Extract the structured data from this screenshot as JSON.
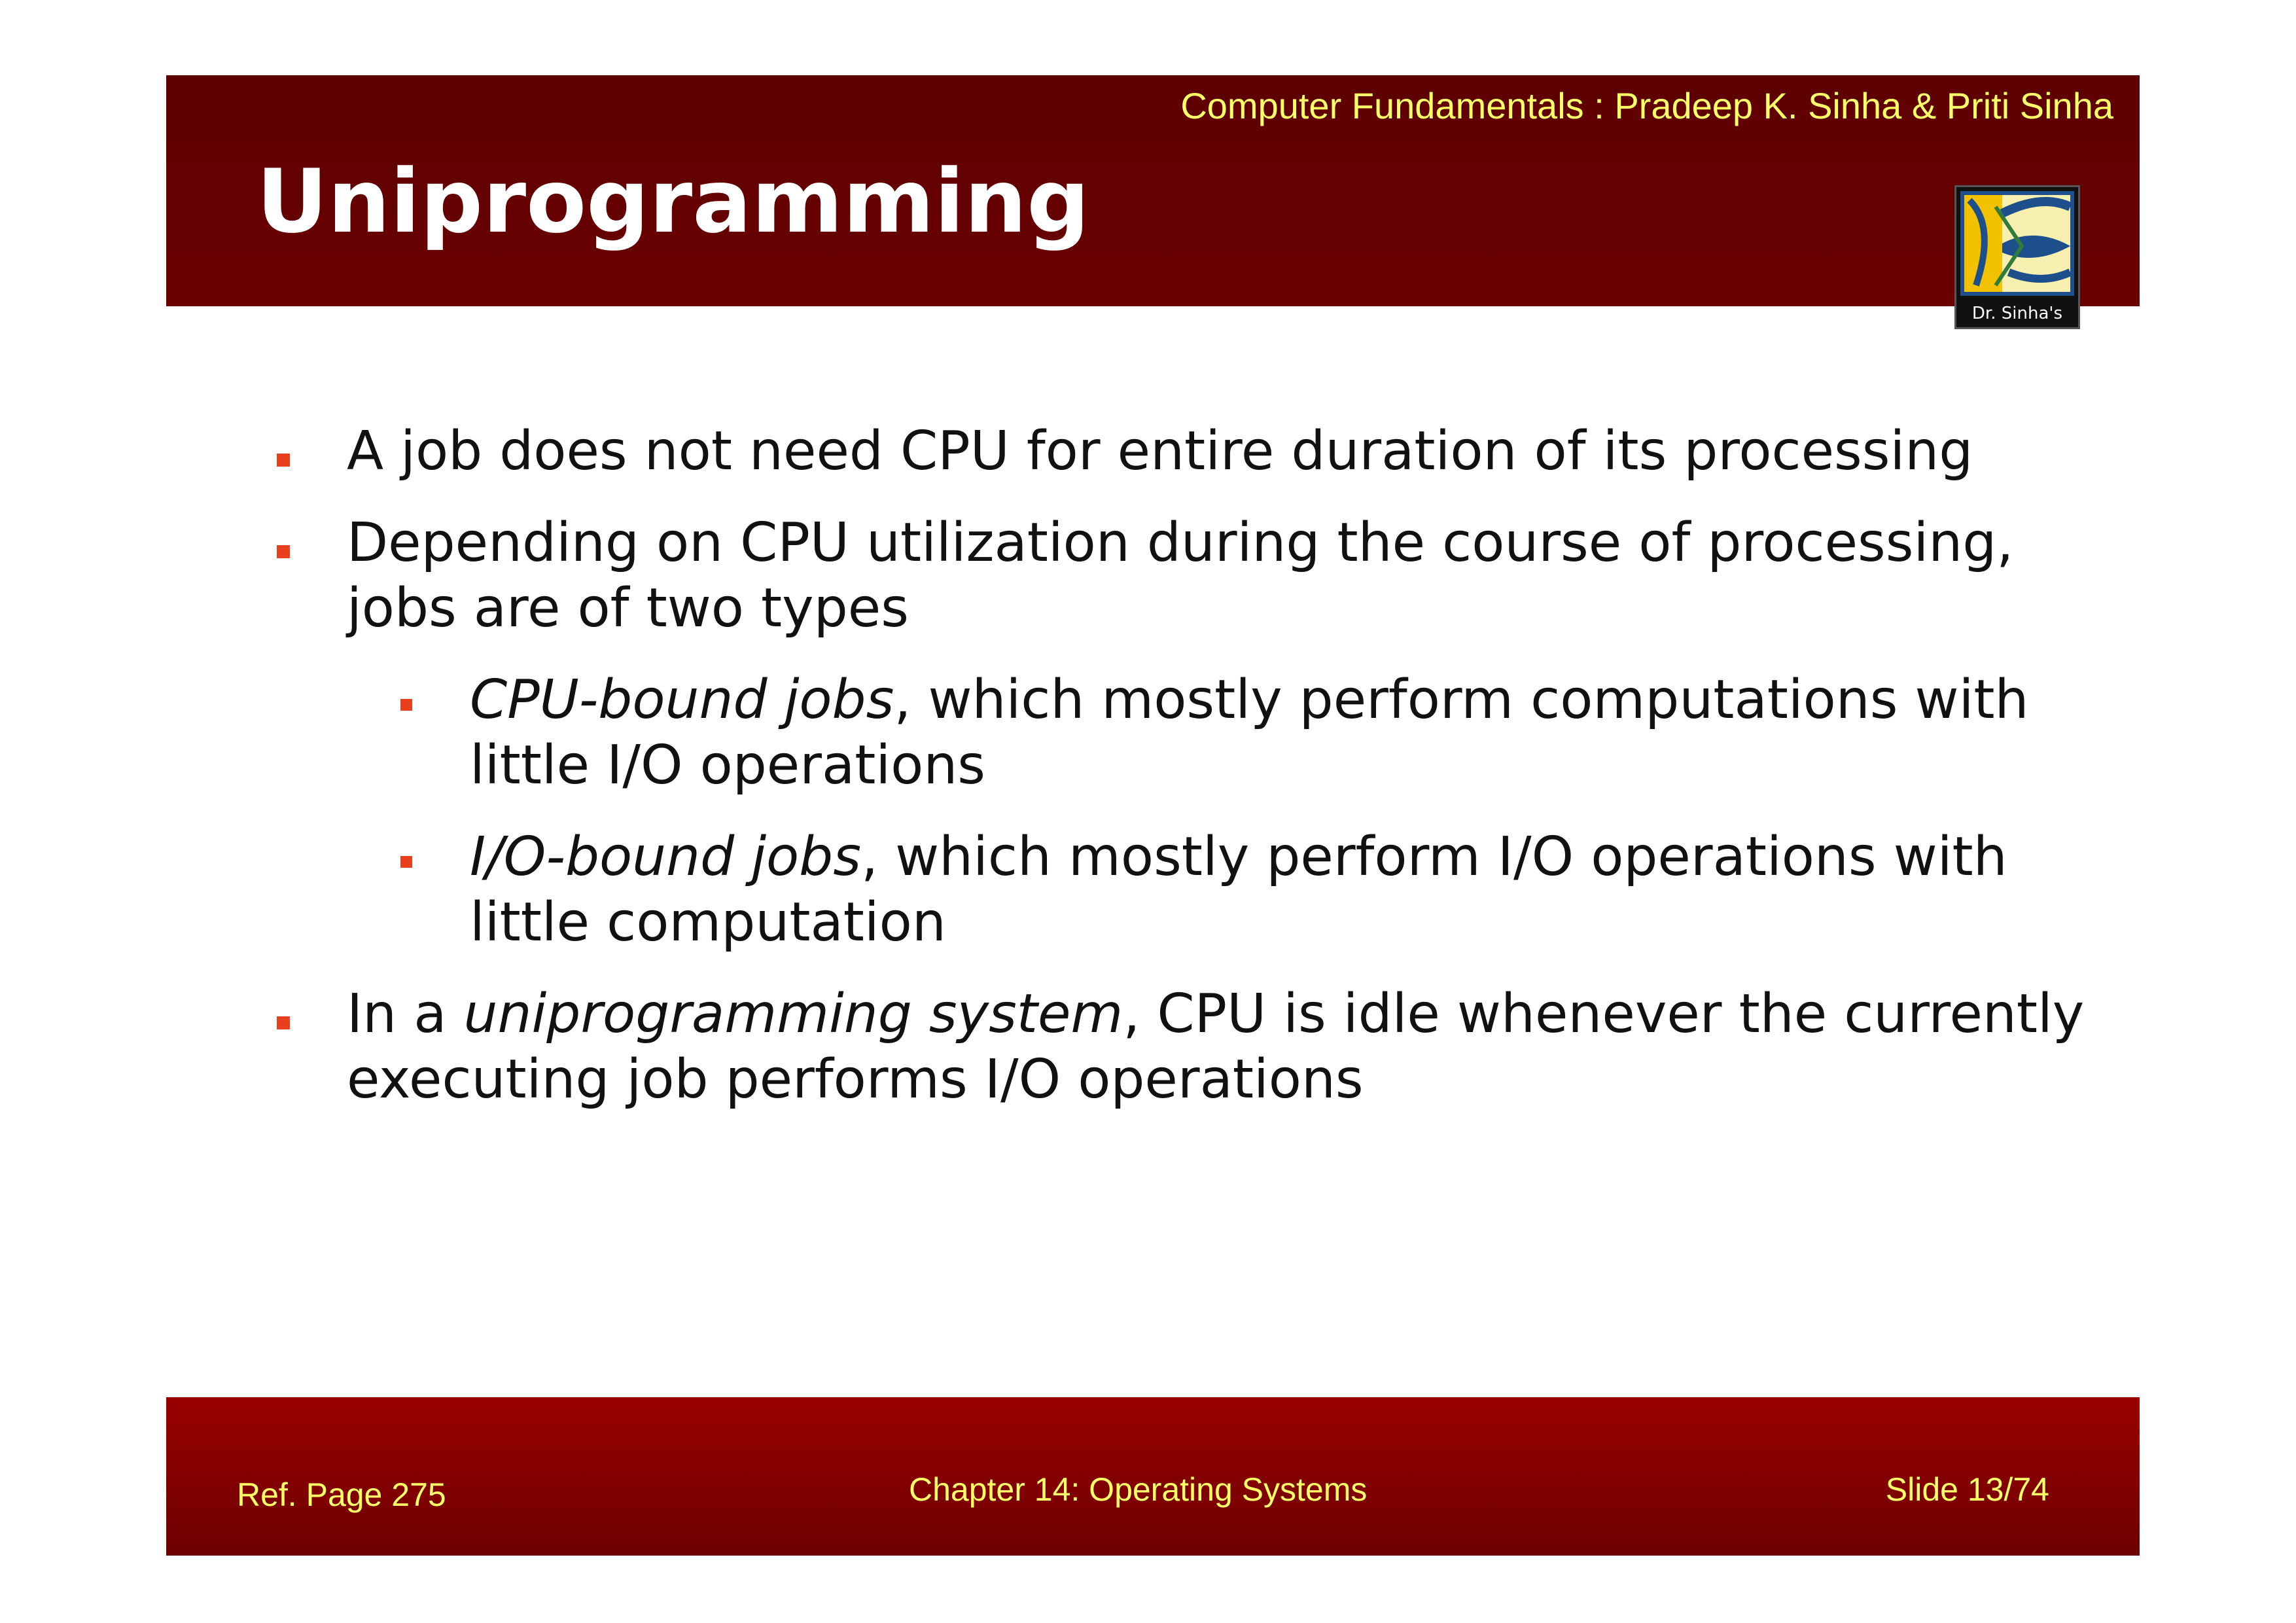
{
  "header": {
    "book_credit": "Computer Fundamentals : Pradeep K. Sinha & Priti Sinha",
    "title": "Uniprogramming",
    "logo_caption": "Dr. Sinha's",
    "logo_icon": "dr-sinhas-logo-icon"
  },
  "bullets": [
    {
      "text": "A job does not need CPU for entire duration of its processing"
    },
    {
      "text": "Depending on CPU utilization during the course of processing, jobs are of two types"
    },
    {
      "em": "CPU-bound jobs",
      "text": ", which mostly perform computations with little I/O operations"
    },
    {
      "em": "I/O-bound jobs",
      "text": ", which mostly perform I/O operations with little computation"
    },
    {
      "pre": "In a ",
      "em": "uniprogramming system",
      "text": ", CPU is idle whenever the currently executing job performs I/O operations"
    }
  ],
  "footer": {
    "ref_page": "Ref. Page  275",
    "chapter": "Chapter 14: Operating Systems",
    "slide": "Slide 13/74"
  },
  "colors": {
    "header_band": "#640000",
    "footer_band": "#880000",
    "bullet_marker": "#e8401c",
    "accent_text": "#ffff66"
  }
}
